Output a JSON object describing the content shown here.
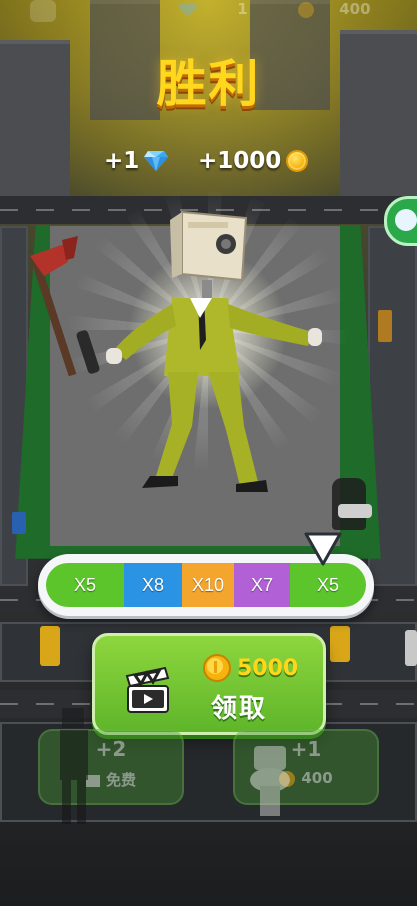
{
  "hud": {
    "left_value": "1",
    "right_value": "400"
  },
  "title": "胜利",
  "rewards": {
    "gems": "+1",
    "coins": "+1000"
  },
  "multiplier": {
    "segments": [
      {
        "label": "X5",
        "color": "#5cc52b"
      },
      {
        "label": "X8",
        "color": "#2b93e4"
      },
      {
        "label": "X10",
        "color": "#f3a52d"
      },
      {
        "label": "X7",
        "color": "#b160d6"
      },
      {
        "label": "X5",
        "color": "#5cc52b"
      }
    ],
    "pointer_segment_index": 4
  },
  "claim": {
    "amount": "5000",
    "label": "领取"
  },
  "upgrades": [
    {
      "value": "+2",
      "sub": "免费"
    },
    {
      "value": "+1",
      "sub": "400"
    }
  ],
  "colors": {
    "title": "#ffd81e",
    "claim_button": "#6cc232",
    "coin": "#f5b30d"
  }
}
